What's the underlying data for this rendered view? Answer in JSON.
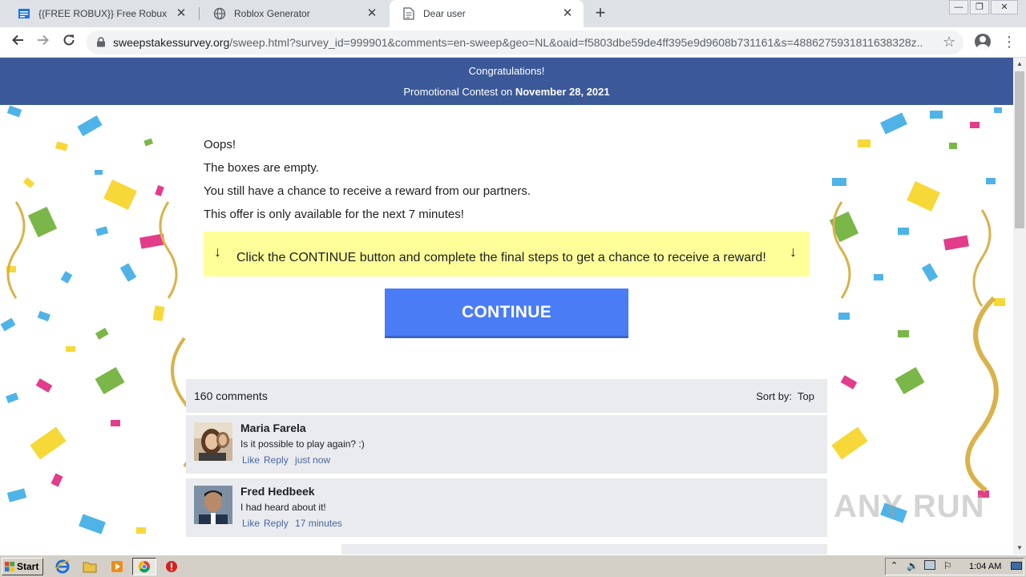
{
  "browser": {
    "tabs": [
      {
        "title": "{{FREE ROBUX}} Free Robux Gener",
        "close": "✕",
        "active": false
      },
      {
        "title": "Roblox Generator",
        "close": "✕",
        "active": false
      },
      {
        "title": "Dear user",
        "close": "✕",
        "active": true
      }
    ],
    "new_tab": "+",
    "url_host": "sweepstakessurvey.org",
    "url_rest": "/sweep.html?survey_id=999901&comments=en-sweep&geo=NL&oaid=f5803dbe59de4ff395e9d9608b731161&s=4886275931811638328z...",
    "icons": {
      "back": "arrow-left-icon",
      "forward": "arrow-right-icon",
      "reload": "reload-icon",
      "lock": "lock-icon",
      "star": "star-icon",
      "profile": "profile-icon",
      "menu": "kebab-menu-icon"
    }
  },
  "banner": {
    "line1": "Congratulations!",
    "line2_prefix": "Promotional Contest on ",
    "line2_date": "November 28, 2021",
    "color": "#3b5998"
  },
  "main": {
    "messages": [
      "Oops!",
      "The boxes are empty.",
      "You still have a chance to receive a reward from our partners.",
      "This offer is only available for the next 7 minutes!"
    ],
    "notice_arrow": "↓",
    "notice_text": "Click the CONTINUE button and complete the final steps to get a chance to receive a reward!",
    "notice_color": "#ffff99",
    "continue_label": "CONTINUE",
    "continue_color": "#4a7cf6"
  },
  "comments": {
    "count_label": "160 comments",
    "sort_label": "Sort by:",
    "sort_value": "Top",
    "items": [
      {
        "name": "Maria Farela",
        "text": "Is it possible to play again? :)",
        "like": "Like",
        "reply": "Reply",
        "time": "just now"
      },
      {
        "name": "Fred Hedbeek",
        "text": "I had heard about it!",
        "like": "Like",
        "reply": "Reply",
        "time": "17 minutes"
      }
    ]
  },
  "watermark": "ANY RUN",
  "taskbar": {
    "start_label": "Start",
    "clock": "1:04 AM",
    "apps": [
      "ie-icon",
      "folder-icon",
      "media-player-icon",
      "chrome-icon",
      "stop-icon"
    ]
  }
}
